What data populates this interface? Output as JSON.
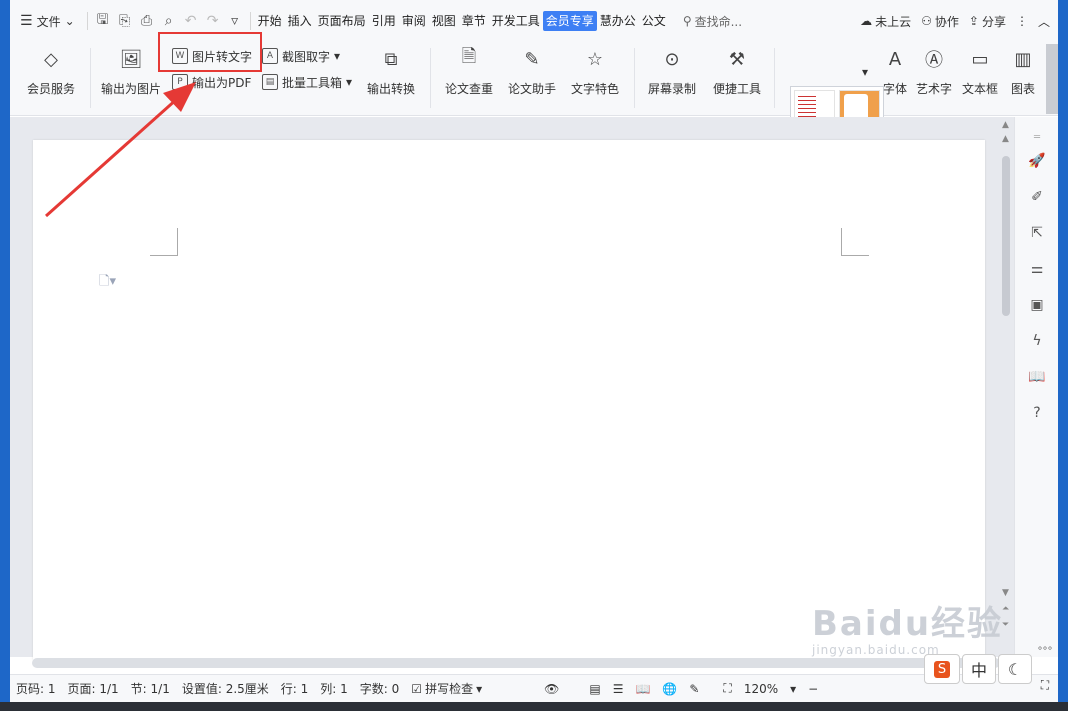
{
  "menu": {
    "file_label": "文件"
  },
  "tabs": [
    {
      "label": "开始"
    },
    {
      "label": "插入"
    },
    {
      "label": "页面布局"
    },
    {
      "label": "引用"
    },
    {
      "label": "审阅"
    },
    {
      "label": "视图"
    },
    {
      "label": "章节"
    },
    {
      "label": "开发工具"
    },
    {
      "label": "会员专享",
      "active": true
    },
    {
      "label": "慧办公"
    },
    {
      "label": "公文"
    }
  ],
  "search": {
    "label": "查找命..."
  },
  "top_right": {
    "cloud": "未上云",
    "collab": "协作",
    "share": "分享"
  },
  "ribbon": {
    "member": "会员服务",
    "export_image": "输出为图片",
    "img_to_text": "图片转文字",
    "export_pdf": "输出为PDF",
    "screenshot_text": "截图取字",
    "batch_tools": "批量工具箱",
    "output_convert": "输出转换",
    "paper_check": "论文查重",
    "paper_assist": "论文助手",
    "text_feature": "文字特色",
    "screen_record": "屏幕录制",
    "quick_tools": "便捷工具",
    "font": "字体",
    "art_text": "艺术字",
    "text_box": "文本框",
    "chart": "图表"
  },
  "status": {
    "page_code": "页码: 1",
    "page": "页面: 1/1",
    "section": "节: 1/1",
    "setting": "设置值: 2.5厘米",
    "row": "行: 1",
    "col": "列: 1",
    "words": "字数: 0",
    "spell": "拼写检查",
    "zoom": "120%"
  },
  "ime": {
    "lang": "中"
  },
  "watermark": {
    "line1": "Baidu经验",
    "line2": "jingyan.baidu.com"
  },
  "colors": {
    "accent": "#3d7ff4",
    "highlight": "#e53935",
    "os_blue": "#1e67c8"
  }
}
